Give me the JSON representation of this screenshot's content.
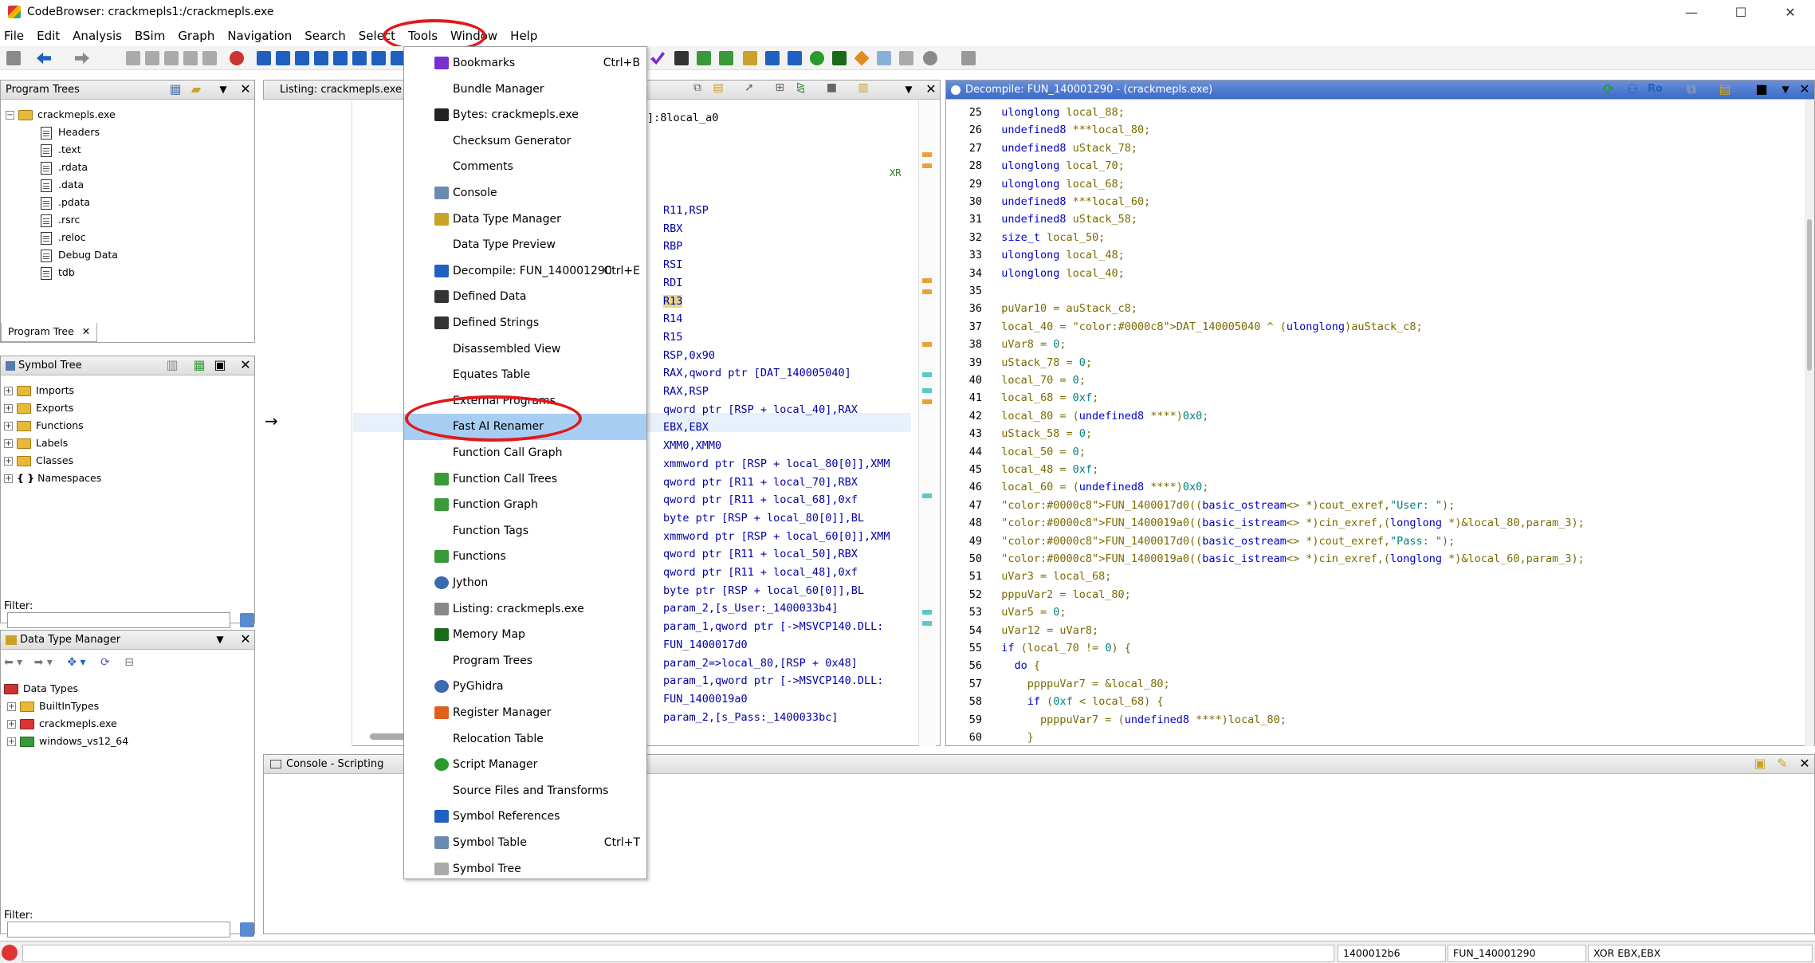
{
  "window": {
    "title": "CodeBrowser: crackmepls1:/crackmepls.exe",
    "min": "—",
    "max": "☐",
    "close": "✕"
  },
  "menubar": [
    "File",
    "Edit",
    "Analysis",
    "BSim",
    "Graph",
    "Navigation",
    "Search",
    "Select",
    "Tools",
    "Window",
    "Help"
  ],
  "program_trees": {
    "title": "Program Trees",
    "root": "crackmepls.exe",
    "items": [
      "Headers",
      ".text",
      ".rdata",
      ".data",
      ".pdata",
      ".rsrc",
      ".reloc",
      "Debug Data",
      "tdb"
    ],
    "tab": "Program Tree"
  },
  "symbol_tree": {
    "title": "Symbol Tree",
    "items": [
      "Imports",
      "Exports",
      "Functions",
      "Labels",
      "Classes",
      "Namespaces"
    ],
    "filter_label": "Filter:"
  },
  "data_type_manager": {
    "title": "Data Type Manager",
    "root": "Data Types",
    "items": [
      "BuiltInTypes",
      "crackmepls.exe",
      "windows_vs12_64"
    ],
    "filter_label": "Filter:"
  },
  "listing": {
    "title": "Listing:  crackmepls.exe",
    "top_lines": [
      "]:8local_a0"
    ],
    "xref_label": "XR",
    "rows": [
      "R11,RSP",
      "RBX",
      "RBP",
      "RSI",
      "RDI",
      "R13",
      "R14",
      "R15",
      "RSP,0x90",
      "RAX,qword ptr [DAT_140005040]",
      "RAX,RSP",
      "qword ptr [RSP + local_40],RAX",
      "EBX,EBX",
      "XMM0,XMM0",
      "xmmword ptr [RSP + local_80[0]],XMM",
      "qword ptr [R11 + local_70],RBX",
      "qword ptr [R11 + local_68],0xf",
      "byte ptr [RSP + local_80[0]],BL",
      "xmmword ptr [RSP + local_60[0]],XMM",
      "qword ptr [R11 + local_50],RBX",
      "qword ptr [R11 + local_48],0xf",
      "byte ptr [RSP + local_60[0]],BL",
      "param_2,[s_User:_1400033b4]",
      "param_1,qword ptr [->MSVCP140.DLL:",
      "FUN_1400017d0",
      "param_2=>local_80,[RSP + 0x48]",
      "param_1,qword ptr [->MSVCP140.DLL:",
      "FUN_1400019a0",
      "param_2,[s_Pass:_1400033bc]"
    ],
    "arrow": "→"
  },
  "decompile": {
    "title": "Decompile: FUN_140001290 -  (crackmepls.exe)",
    "lines": [
      {
        "n": "25",
        "t": "  ulonglong local_88;"
      },
      {
        "n": "26",
        "t": "  undefined8 ***local_80;"
      },
      {
        "n": "27",
        "t": "  undefined8 uStack_78;"
      },
      {
        "n": "28",
        "t": "  ulonglong local_70;"
      },
      {
        "n": "29",
        "t": "  ulonglong local_68;"
      },
      {
        "n": "30",
        "t": "  undefined8 ***local_60;"
      },
      {
        "n": "31",
        "t": "  undefined8 uStack_58;"
      },
      {
        "n": "32",
        "t": "  size_t local_50;"
      },
      {
        "n": "33",
        "t": "  ulonglong local_48;"
      },
      {
        "n": "34",
        "t": "  ulonglong local_40;"
      },
      {
        "n": "35",
        "t": ""
      },
      {
        "n": "36",
        "t": "  puVar10 = auStack_c8;"
      },
      {
        "n": "37",
        "t": "  local_40 = DAT_140005040 ^ (ulonglong)auStack_c8;"
      },
      {
        "n": "38",
        "t": "  uVar8 = 0;"
      },
      {
        "n": "39",
        "t": "  uStack_78 = 0;"
      },
      {
        "n": "40",
        "t": "  local_70 = 0;"
      },
      {
        "n": "41",
        "t": "  local_68 = 0xf;"
      },
      {
        "n": "42",
        "t": "  local_80 = (undefined8 ****)0x0;"
      },
      {
        "n": "43",
        "t": "  uStack_58 = 0;"
      },
      {
        "n": "44",
        "t": "  local_50 = 0;"
      },
      {
        "n": "45",
        "t": "  local_48 = 0xf;"
      },
      {
        "n": "46",
        "t": "  local_60 = (undefined8 ****)0x0;"
      },
      {
        "n": "47",
        "t": "  FUN_1400017d0((basic_ostream<> *)cout_exref,\"User: \");"
      },
      {
        "n": "48",
        "t": "  FUN_1400019a0((basic_istream<> *)cin_exref,(longlong *)&local_80,param_3);"
      },
      {
        "n": "49",
        "t": "  FUN_1400017d0((basic_ostream<> *)cout_exref,\"Pass: \");"
      },
      {
        "n": "50",
        "t": "  FUN_1400019a0((basic_istream<> *)cin_exref,(longlong *)&local_60,param_3);"
      },
      {
        "n": "51",
        "t": "  uVar3 = local_68;"
      },
      {
        "n": "52",
        "t": "  pppuVar2 = local_80;"
      },
      {
        "n": "53",
        "t": "  uVar5 = 0;"
      },
      {
        "n": "54",
        "t": "  uVar12 = uVar8;"
      },
      {
        "n": "55",
        "t": "  if (local_70 != 0) {"
      },
      {
        "n": "56",
        "t": "    do {"
      },
      {
        "n": "57",
        "t": "      ppppuVar7 = &local_80;"
      },
      {
        "n": "58",
        "t": "      if (0xf < local_68) {"
      },
      {
        "n": "59",
        "t": "        ppppuVar7 = (undefined8 ****)local_80;"
      },
      {
        "n": "60",
        "t": "      }"
      }
    ]
  },
  "console": {
    "title": "Console - Scripting"
  },
  "window_menu": {
    "items": [
      {
        "label": "Bookmarks",
        "accel": "Ctrl+B",
        "icon": "checkmark-icon"
      },
      {
        "label": "Bundle Manager",
        "accel": "",
        "icon": ""
      },
      {
        "label": "Bytes: crackmepls.exe",
        "accel": "",
        "icon": "binary-icon"
      },
      {
        "label": "Checksum Generator",
        "accel": "",
        "icon": ""
      },
      {
        "label": "Comments",
        "accel": "",
        "icon": ""
      },
      {
        "label": "Console",
        "accel": "",
        "icon": "monitor-icon"
      },
      {
        "label": "Data Type Manager",
        "accel": "",
        "icon": "datatype-icon"
      },
      {
        "label": "Data Type Preview",
        "accel": "",
        "icon": ""
      },
      {
        "label": "Decompile: FUN_140001290",
        "accel": "Ctrl+E",
        "icon": "decompile-icon"
      },
      {
        "label": "Defined Data",
        "accel": "",
        "icon": "dat-icon"
      },
      {
        "label": "Defined Strings",
        "accel": "",
        "icon": "dat-icon"
      },
      {
        "label": "Disassembled View",
        "accel": "",
        "icon": ""
      },
      {
        "label": "Equates Table",
        "accel": "",
        "icon": ""
      },
      {
        "label": "External Programs",
        "accel": "",
        "icon": ""
      },
      {
        "label": "Fast AI Renamer",
        "accel": "",
        "icon": ""
      },
      {
        "label": "Function Call Graph",
        "accel": "",
        "icon": ""
      },
      {
        "label": "Function Call Trees",
        "accel": "",
        "icon": "call-tree-icon"
      },
      {
        "label": "Function Graph",
        "accel": "",
        "icon": "graph-icon"
      },
      {
        "label": "Function Tags",
        "accel": "",
        "icon": ""
      },
      {
        "label": "Functions",
        "accel": "",
        "icon": "functions-icon"
      },
      {
        "label": "Jython",
        "accel": "",
        "icon": "python-icon"
      },
      {
        "label": "Listing:  crackmepls.exe",
        "accel": "",
        "icon": "listing-icon"
      },
      {
        "label": "Memory Map",
        "accel": "",
        "icon": "memory-icon"
      },
      {
        "label": "Program Trees",
        "accel": "",
        "icon": ""
      },
      {
        "label": "PyGhidra",
        "accel": "",
        "icon": "python-icon"
      },
      {
        "label": "Register Manager",
        "accel": "",
        "icon": "register-icon"
      },
      {
        "label": "Relocation Table",
        "accel": "",
        "icon": ""
      },
      {
        "label": "Script Manager",
        "accel": "",
        "icon": "play-icon"
      },
      {
        "label": "Source Files and Transforms",
        "accel": "",
        "icon": ""
      },
      {
        "label": "Symbol References",
        "accel": "",
        "icon": "symbol-ref-icon"
      },
      {
        "label": "Symbol Table",
        "accel": "Ctrl+T",
        "icon": "table-icon"
      },
      {
        "label": "Symbol Tree",
        "accel": "",
        "icon": "tree-icon"
      }
    ],
    "selected": "Fast AI Renamer"
  },
  "statusbar": {
    "address": "1400012b6",
    "function": "FUN_140001290",
    "instruction": "XOR EBX,EBX"
  },
  "colors": {
    "accent_ring": "#e0191b",
    "selection": "#a8cdf2",
    "active_title": "#3b6ac9"
  }
}
